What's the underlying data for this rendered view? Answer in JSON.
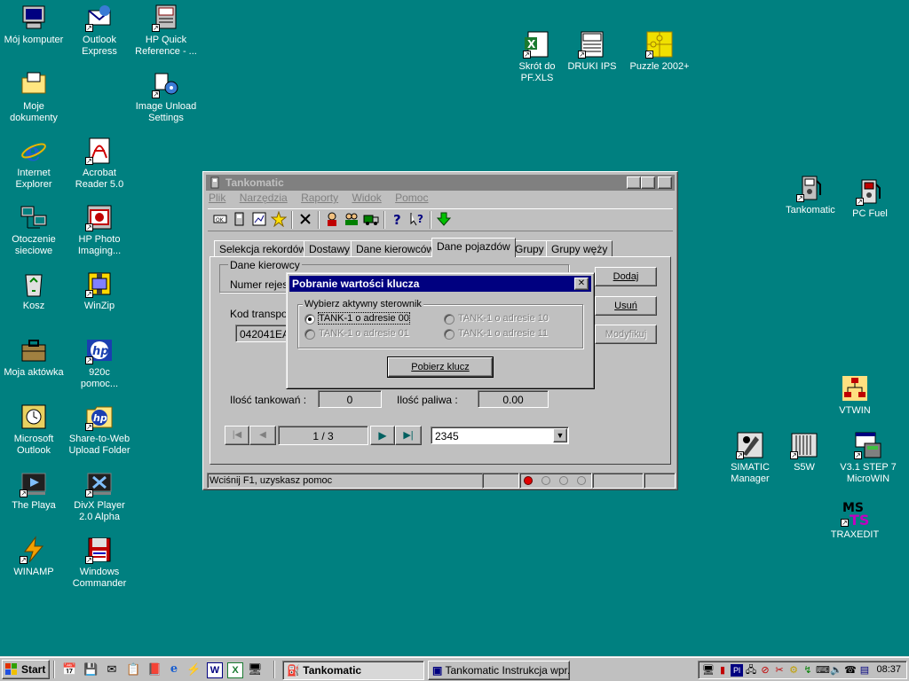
{
  "desktop": {
    "icons": [
      {
        "id": "my-computer",
        "label": "Mój komputer",
        "glyph": "🖥"
      },
      {
        "id": "outlook-express",
        "label": "Outlook\nExpress",
        "glyph": "✉"
      },
      {
        "id": "hp-quick-reference",
        "label": "HP Quick\nReference - ...",
        "glyph": "📖"
      },
      {
        "id": "my-documents",
        "label": "Moje\ndokumenty",
        "glyph": "📁"
      },
      {
        "id": "image-unload-settings",
        "label": "Image Unload\nSettings",
        "glyph": "⚙"
      },
      {
        "id": "internet-explorer",
        "label": "Internet\nExplorer",
        "glyph": "e"
      },
      {
        "id": "acrobat-reader",
        "label": "Acrobat\nReader 5.0",
        "glyph": "A"
      },
      {
        "id": "network-neighborhood",
        "label": "Otoczenie\nsieciowe",
        "glyph": "🖧"
      },
      {
        "id": "hp-photo-imaging",
        "label": "HP Photo\nImaging...",
        "glyph": "📷"
      },
      {
        "id": "recycle-bin",
        "label": "Kosz",
        "glyph": "🗑"
      },
      {
        "id": "winzip",
        "label": "WinZip",
        "glyph": "🗜"
      },
      {
        "id": "briefcase",
        "label": "Moja aktówka",
        "glyph": "💼"
      },
      {
        "id": "hp-920c",
        "label": "920c\npomoc...",
        "glyph": "hp"
      },
      {
        "id": "microsoft-outlook",
        "label": "Microsoft\nOutlook",
        "glyph": "📅"
      },
      {
        "id": "share-to-web",
        "label": "Share-to-Web\nUpload Folder",
        "glyph": "hp"
      },
      {
        "id": "the-playa",
        "label": "The Playa",
        "glyph": "▶"
      },
      {
        "id": "divx-player",
        "label": "DivX Player\n2.0 Alpha",
        "glyph": "✖"
      },
      {
        "id": "winamp",
        "label": "WINAMP",
        "glyph": "⚡"
      },
      {
        "id": "windows-commander",
        "label": "Windows\nCommander",
        "glyph": "💾"
      },
      {
        "id": "skrot-pf-xls",
        "label": "Skrót do\nPF.XLS",
        "glyph": "X"
      },
      {
        "id": "druki-ips",
        "label": "DRUKI IPS",
        "glyph": "📄"
      },
      {
        "id": "puzzle-2002",
        "label": "Puzzle 2002+",
        "glyph": "🧩"
      },
      {
        "id": "tankomatic",
        "label": "Tankomatic",
        "glyph": "⛽"
      },
      {
        "id": "pc-fuel",
        "label": "PC Fuel",
        "glyph": "⛽"
      },
      {
        "id": "vtwin",
        "label": "VTWIN",
        "glyph": "品"
      },
      {
        "id": "simatic-manager",
        "label": "SIMATIC\nManager",
        "glyph": "✎"
      },
      {
        "id": "s5w",
        "label": "S5W",
        "glyph": "▥"
      },
      {
        "id": "step7-microwin",
        "label": "V3.1 STEP 7\nMicroWIN",
        "glyph": "▣"
      },
      {
        "id": "traxedit",
        "label": "TRAXEDIT",
        "glyph": "MS"
      }
    ]
  },
  "window": {
    "title": "Tankomatic",
    "menu": [
      "Plik",
      "Narzędzia",
      "Raporty",
      "Widok",
      "Pomoc"
    ],
    "tabs": [
      "Selekcja rekordów",
      "Dostawy",
      "Dane kierowców",
      "Dane pojazdów",
      "Grupy",
      "Grupy węży"
    ],
    "group_title": "Dane kierowcy",
    "registration_label": "Numer rejestra",
    "transponder_label": "Kod transpon",
    "transponder_value": "042041EA4",
    "refuel_count_label": "Ilość tankowań :",
    "refuel_count_value": "0",
    "fuel_amount_label": "Ilość paliwa :",
    "fuel_amount_value": "0.00",
    "buttons": {
      "add": "Dodaj",
      "delete": "Usuń",
      "modify": "Modyfikuj"
    },
    "navigator": {
      "position": "1 / 3",
      "combo_value": "2345"
    },
    "status_text": "Wciśnij F1, uzyskasz pomoc"
  },
  "dialog": {
    "title": "Pobranie wartości klucza",
    "group_label": "Wybierz aktywny sterownik",
    "options": [
      {
        "label": "TANK-1 o adresie 00",
        "selected": true,
        "enabled": true
      },
      {
        "label": "TANK-1 o adresie 10",
        "selected": false,
        "enabled": false
      },
      {
        "label": "TANK-1 o adresie 01",
        "selected": false,
        "enabled": false
      },
      {
        "label": "TANK-1 o adresie 11",
        "selected": false,
        "enabled": false
      }
    ],
    "action_button": "Pobierz klucz"
  },
  "taskbar": {
    "start_label": "Start",
    "tasks": [
      {
        "label": "Tankomatic",
        "active": true
      },
      {
        "label": "Tankomatic Instrukcja wpr...",
        "active": false
      }
    ],
    "clock": "08:37"
  }
}
